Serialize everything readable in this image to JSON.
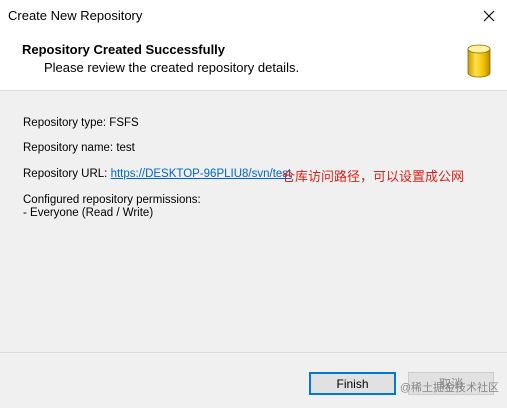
{
  "window": {
    "title": "Create New Repository"
  },
  "header": {
    "title": "Repository Created Successfully",
    "subtitle": "Please review the created repository details.",
    "icon": "database-icon"
  },
  "details": {
    "type_line": "Repository type: FSFS",
    "name_line": "Repository name: test",
    "url_label": "Repository URL: ",
    "url_value": "https://DESKTOP-96PLIU8/svn/test",
    "annotation": "仓库访问路径，可以设置成公网",
    "permissions_label": "Configured repository permissions:",
    "permissions_value": "- Everyone (Read / Write)"
  },
  "footer": {
    "finish_label": "Finish",
    "cancel_label": "取消",
    "watermark": "@稀土掘金技术社区"
  },
  "colors": {
    "link": "#0066cc",
    "annotation": "#e0201a",
    "focus_border": "#0078d7"
  }
}
